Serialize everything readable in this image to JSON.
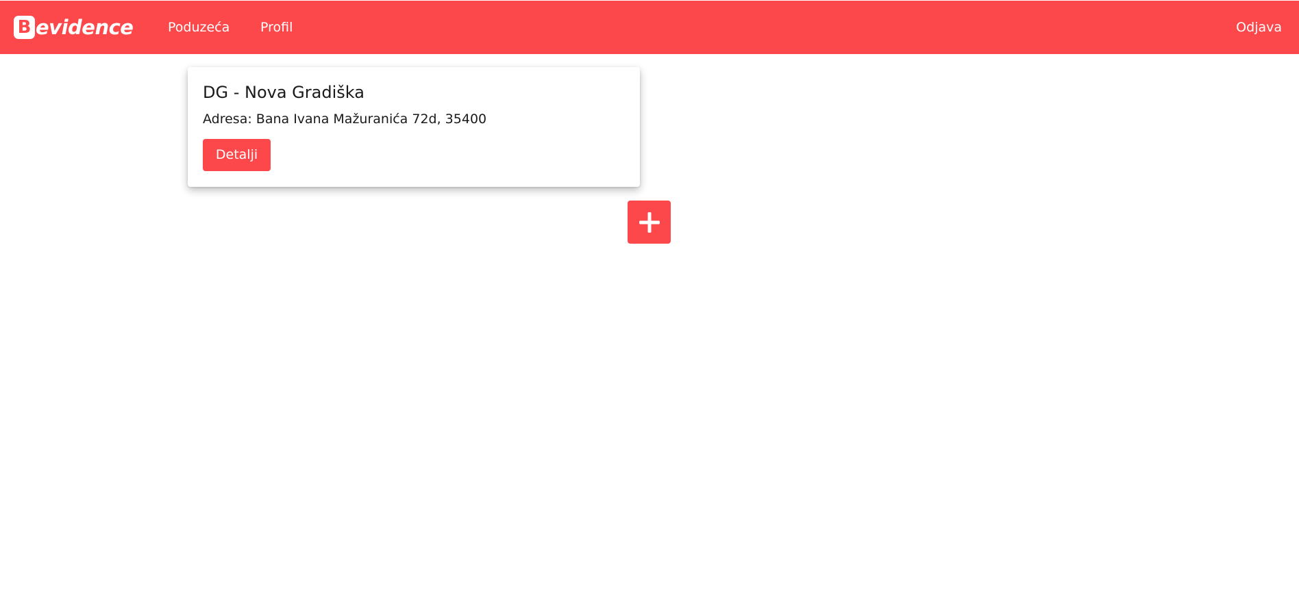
{
  "navbar": {
    "brand_letter": "B",
    "brand_text": "evidence",
    "links": [
      {
        "label": "Poduzeća"
      },
      {
        "label": "Profil"
      }
    ],
    "logout_label": "Odjava"
  },
  "card": {
    "title": "DG - Nova Gradiška",
    "address": "Adresa: Bana Ivana Mažuranića 72d, 35400",
    "details_label": "Detalji"
  },
  "add_button": {
    "icon": "plus-icon"
  },
  "colors": {
    "accent": "#fc484b",
    "background": "#ffffff",
    "text": "#1a1a1a"
  }
}
